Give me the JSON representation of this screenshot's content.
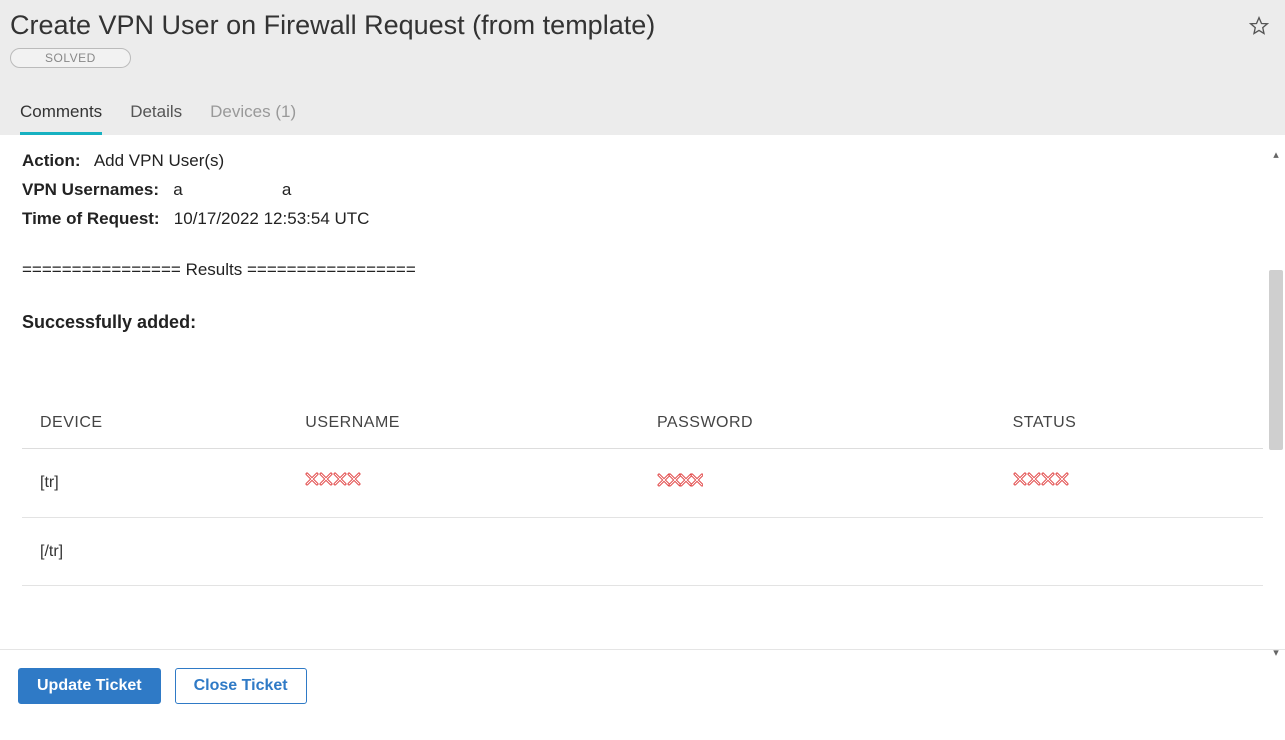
{
  "header": {
    "title": "Create VPN User on Firewall Request (from template)",
    "status": "SOLVED"
  },
  "tabs": [
    {
      "label": "Comments",
      "active": true
    },
    {
      "label": "Details",
      "active": false
    },
    {
      "label": "Devices (1)",
      "active": false,
      "muted": true
    }
  ],
  "body": {
    "action_label": "Action:",
    "action_value": "Add VPN User(s)",
    "usernames_label": "VPN Usernames:",
    "usernames_value": "a                     a",
    "time_label": "Time of Request:",
    "time_value": "10/17/2022 12:53:54 UTC",
    "results_sep": "================ Results =================",
    "success_line": "Successfully added:"
  },
  "table": {
    "columns": [
      "DEVICE",
      "USERNAME",
      "PASSWORD",
      "STATUS"
    ],
    "rows": [
      {
        "device": "[tr]",
        "username": "XXXX",
        "password": "XXXX",
        "status": "XXXX",
        "redacted": true
      },
      {
        "device": "[/tr]",
        "username": "",
        "password": "",
        "status": "",
        "redacted": false
      }
    ]
  },
  "footer": {
    "update_label": "Update Ticket",
    "close_label": "Close Ticket"
  }
}
